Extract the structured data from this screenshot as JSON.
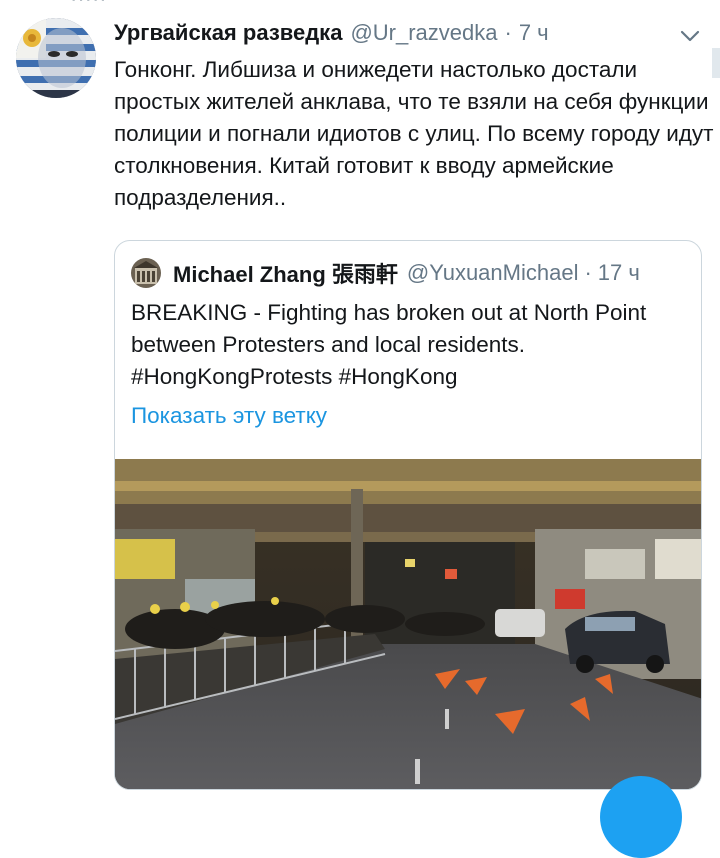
{
  "tweet": {
    "author_name": "Ургвайская разведка",
    "handle": "@Ur_razvedka",
    "separator": "·",
    "time": "7 ч",
    "text": "Гонконг. Либшиза и онижедети настолько достали простых жителей анклава, что те взяли на себя функции полиции и погнали идиотов с улиц. По всему городу идут столкновения. Китай готовит к вводу армейские подразделения.."
  },
  "quoted_tweet": {
    "author_name": "Michael Zhang 張雨軒",
    "handle": "@YuxuanMichael",
    "separator": "·",
    "time": "17 ч",
    "text": "BREAKING - Fighting has broken out at North Point between Protesters and local residents. #HongKongProtests #HongKong",
    "show_thread_label": "Показать эту ветку"
  },
  "icons": {
    "menu": "chevron-down-icon",
    "compose": "compose-fab-icon"
  },
  "colors": {
    "link": "#1b95e0",
    "secondary_text": "#657786",
    "border": "#ccd6dd",
    "fab": "#1da1f2"
  }
}
